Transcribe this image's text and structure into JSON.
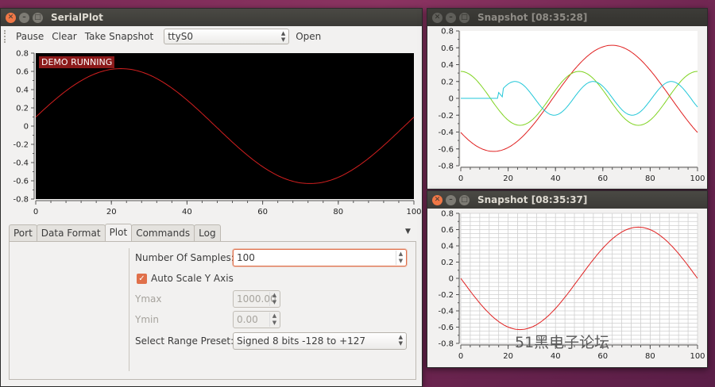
{
  "main_window": {
    "title": "SerialPlot",
    "toolbar": {
      "pause": "Pause",
      "clear": "Clear",
      "snapshot": "Take Snapshot",
      "port_value": "ttyS0",
      "open": "Open"
    },
    "demo_badge": "DEMO RUNNING",
    "tabs": [
      "Port",
      "Data Format",
      "Plot",
      "Commands",
      "Log"
    ],
    "active_tab": "Plot",
    "plot_settings": {
      "num_samples_label": "Number Of Samples:",
      "num_samples_value": "100",
      "auto_scale_label": "Auto Scale Y Axis",
      "ymax_label": "Ymax",
      "ymax_value": "1000.00",
      "ymin_label": "Ymin",
      "ymin_value": "0.00",
      "preset_label": "Select Range Preset:",
      "preset_value": "Signed 8 bits -128 to +127"
    }
  },
  "snapshot1": {
    "title": "Snapshot [08:35:28]"
  },
  "snapshot2": {
    "title": "Snapshot [08:35:37]"
  },
  "watermark": "51黑电子论坛",
  "chart_data": [
    {
      "type": "line",
      "id": "main",
      "xlim": [
        0,
        100
      ],
      "ylim": [
        -0.8,
        0.8
      ],
      "x_ticks": [
        0,
        20,
        40,
        60,
        80,
        100
      ],
      "y_ticks": [
        0.8,
        0.6,
        0.4,
        0.2,
        0,
        -0.2,
        -0.4,
        -0.6,
        -0.8
      ],
      "series": [
        {
          "color": "#d21f1f",
          "amplitude": 0.63,
          "phase_deg": 9,
          "period": 100
        }
      ]
    },
    {
      "type": "line",
      "id": "snapshot1",
      "xlim": [
        0,
        100
      ],
      "ylim": [
        -0.8,
        0.8
      ],
      "x_ticks": [
        0,
        20,
        40,
        60,
        80,
        100
      ],
      "y_ticks": [
        0.8,
        0.6,
        0.4,
        0.2,
        0,
        -0.2,
        -0.4,
        -0.6,
        -0.8
      ],
      "series": [
        {
          "color": "#e02020",
          "amplitude": 0.63,
          "phase_deg": 220,
          "period": 100
        },
        {
          "color": "#7fd320",
          "amplitude": 0.32,
          "phase_deg": 90,
          "period": 50
        },
        {
          "color": "#22c7d8",
          "flat_until": 16,
          "amplitude": 0.2,
          "phase_deg": 200,
          "period": 33
        }
      ]
    },
    {
      "type": "line",
      "id": "snapshot2",
      "xlim": [
        0,
        100
      ],
      "ylim": [
        -0.8,
        0.8
      ],
      "x_ticks": [
        0,
        20,
        40,
        60,
        80,
        100
      ],
      "y_ticks": [
        0.8,
        0.6,
        0.4,
        0.2,
        0,
        -0.2,
        -0.4,
        -0.6,
        -0.8
      ],
      "grid": true,
      "series": [
        {
          "color": "#e02020",
          "amplitude": 0.63,
          "phase_deg": 180,
          "period": 100
        }
      ]
    }
  ]
}
